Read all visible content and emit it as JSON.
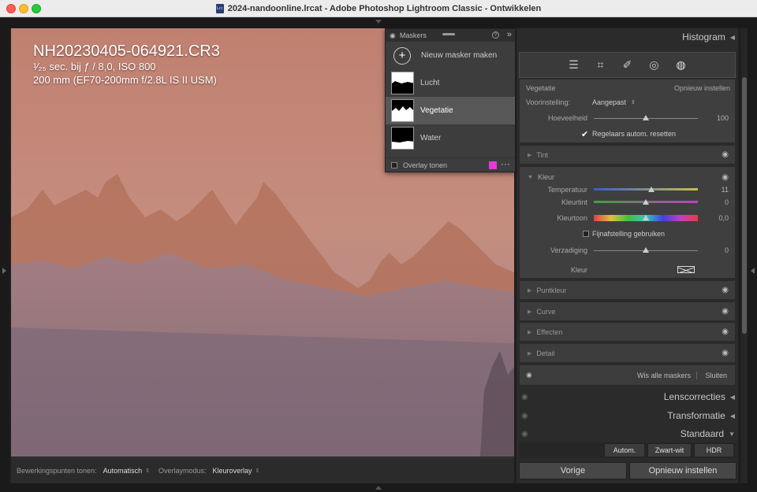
{
  "window": {
    "title": "2024-nandoonline.lrcat - Adobe Photoshop Lightroom Classic - Ontwikkelen",
    "file_icon_text": "Lrc"
  },
  "photo_info": {
    "filename": "NH20230405-064921.CR3",
    "exposure": "¹⁄₂₅ sec. bij ƒ / 8,0, ISO 800",
    "lens": "200 mm (EF70-200mm f/2.8L IS II USM)"
  },
  "masks_panel": {
    "title": "Maskers",
    "new_mask": "Nieuw masker maken",
    "items": [
      {
        "label": "Lucht"
      },
      {
        "label": "Vegetatie"
      },
      {
        "label": "Water"
      }
    ],
    "overlay_label": "Overlay tonen",
    "overlay_color": "#e33ad6"
  },
  "bottom_toolbar": {
    "points_label": "Bewerkingspunten tonen:",
    "points_value": "Automatisch",
    "overlay_mode_label": "Overlaymodus:",
    "overlay_mode_value": "Kleuroverlay"
  },
  "right_panel": {
    "histogram": "Histogram",
    "mask_section": {
      "name": "Vegetatie",
      "reset": "Opnieuw instellen",
      "preset_label": "Voorinstelling:",
      "preset_value": "Aangepast",
      "amount_label": "Hoeveelheid",
      "amount_value": "100",
      "amount_level": 0.5,
      "reset_sliders": "Regelaars autom. resetten"
    },
    "tint_section": "Tint",
    "color_section": {
      "title": "Kleur",
      "temperature": {
        "label": "Temperatuur",
        "value": "11",
        "level": 0.55
      },
      "tint": {
        "label": "Kleurtint",
        "value": "0",
        "level": 0.5
      },
      "hue": {
        "label": "Kleurtoon",
        "value": "0,0",
        "level": 0.5
      },
      "fine_tune": "Fijnafstelling gebruiken",
      "saturation": {
        "label": "Verzadiging",
        "value": "0",
        "level": 0.5
      },
      "color_label": "Kleur"
    },
    "sections": [
      "Puntkleur",
      "Curve",
      "Effecten",
      "Detail"
    ],
    "clear_all": "Wis alle maskers",
    "close": "Sluiten",
    "lens_corrections": "Lenscorrecties",
    "transform": "Transformatie",
    "standard": "Standaard",
    "auto_btn": "Autom.",
    "bw_btn": "Zwart-wit",
    "hdr_btn": "HDR",
    "previous_btn": "Vorige",
    "reset_btn": "Opnieuw instellen"
  }
}
